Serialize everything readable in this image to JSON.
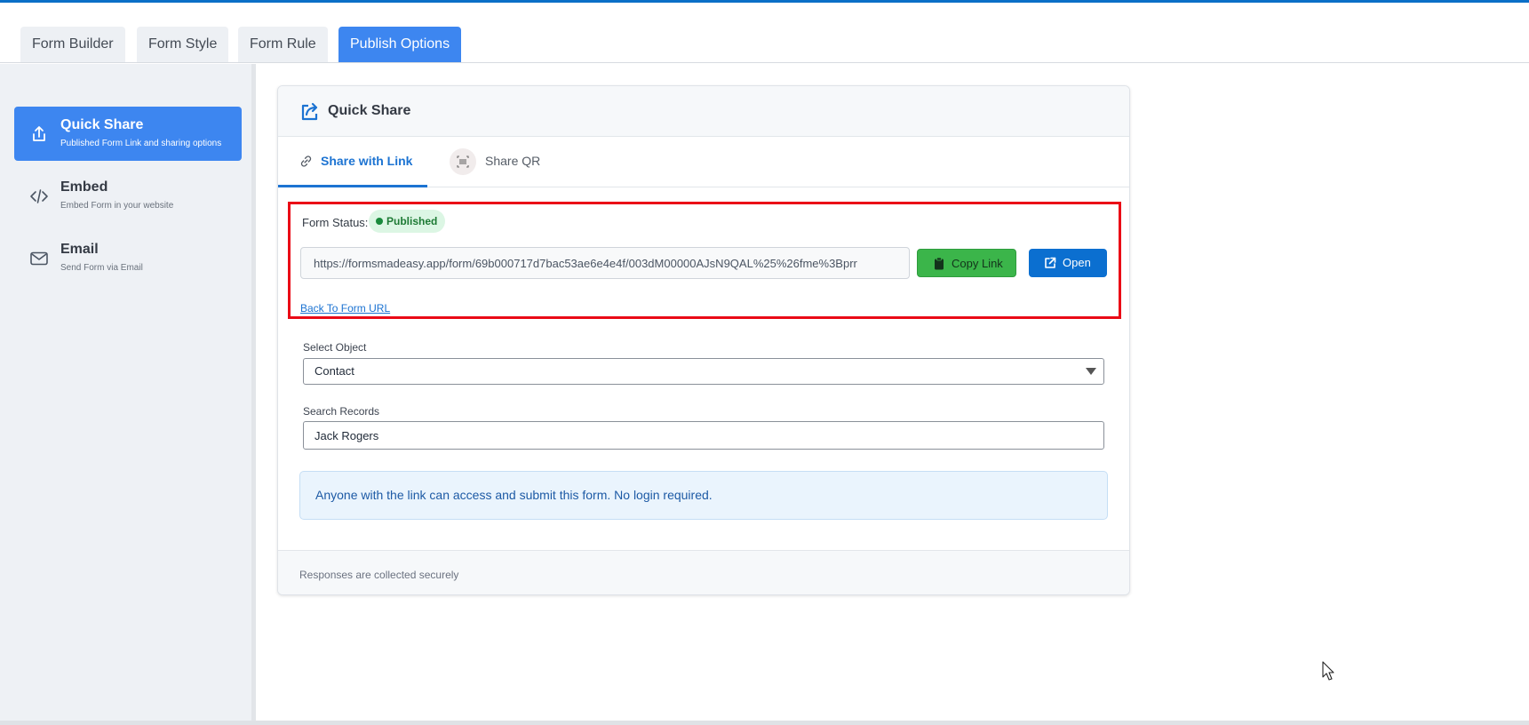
{
  "tabs": [
    {
      "label": "Form Builder"
    },
    {
      "label": "Form Style"
    },
    {
      "label": "Form Rule"
    },
    {
      "label": "Publish Options"
    }
  ],
  "sidebar": {
    "items": [
      {
        "title": "Quick Share",
        "subtitle": "Published Form Link and sharing options",
        "icon": "share-upload-icon"
      },
      {
        "title": "Embed",
        "subtitle": "Embed Form in your website",
        "icon": "code-icon"
      },
      {
        "title": "Email",
        "subtitle": "Send Form via Email",
        "icon": "envelope-icon"
      }
    ]
  },
  "card": {
    "title": "Quick Share",
    "subtabs": [
      {
        "label": "Share with Link"
      },
      {
        "label": "Share QR"
      }
    ],
    "status_label": "Form Status:",
    "status_badge": "Published",
    "url": "https://formsmadeasy.app/form/69b000717d7bac53ae6e4e4f/003dM00000AJsN9QAL%25%26fme%3Bprr",
    "copy_label": "Copy Link",
    "open_label": "Open",
    "back_link": "Back To Form URL",
    "select_object_label": "Select Object",
    "select_object_value": "Contact",
    "search_label": "Search Records",
    "search_value": "Jack Rogers",
    "info_text": "Anyone with the link can access and submit this form. No login required.",
    "footer_text": "Responses are collected securely"
  },
  "colors": {
    "accent": "#3d86f0",
    "link": "#1c73d2",
    "success": "#3bb54a",
    "highlight_border": "#ea0a16"
  }
}
